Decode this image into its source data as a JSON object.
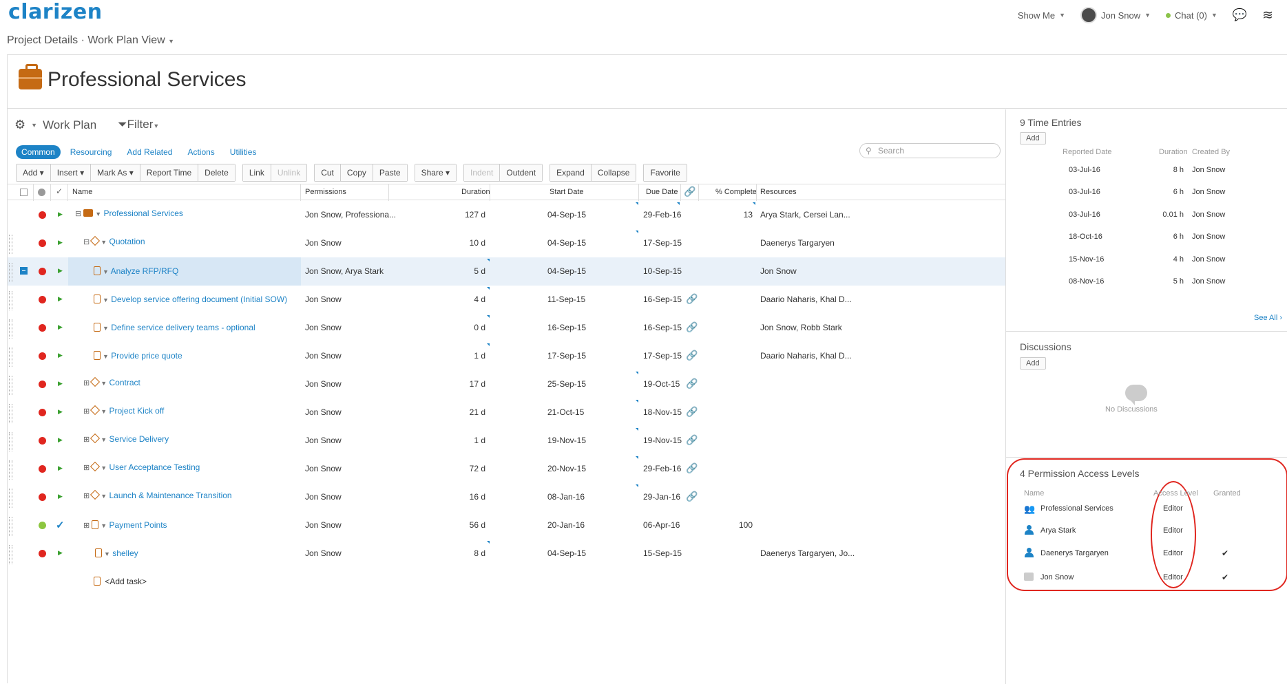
{
  "app": {
    "logo": "clarizen"
  },
  "topnav": {
    "show_me": "Show Me",
    "user": "Jon Snow",
    "chat": "Chat (0)"
  },
  "breadcrumb": "Project Details · Work Plan View",
  "page_title": "Professional Services",
  "workplan": {
    "label": "Work Plan",
    "filter": "Filter"
  },
  "subtabs": [
    "Common",
    "Resourcing",
    "Add Related",
    "Actions",
    "Utilities"
  ],
  "search_placeholder": "Search",
  "toolbar": {
    "g1": [
      "Add ▾",
      "Insert ▾",
      "Mark As ▾",
      "Report Time",
      "Delete"
    ],
    "g2": [
      "Link",
      "Unlink"
    ],
    "g3": [
      "Cut",
      "Copy",
      "Paste"
    ],
    "g4": [
      "Share ▾"
    ],
    "g5": [
      "Indent",
      "Outdent"
    ],
    "g6": [
      "Expand",
      "Collapse"
    ],
    "g7": [
      "Favorite"
    ]
  },
  "columns": {
    "name": "Name",
    "permissions": "Permissions",
    "duration": "Duration",
    "start": "Start Date",
    "due": "Due Date",
    "complete": "% Complete",
    "resources": "Resources"
  },
  "rows": [
    {
      "name": "Professional Services",
      "perm": "Jon Snow, Professiona...",
      "dur": "127 d",
      "start": "04-Sep-15",
      "due": "29-Feb-16",
      "pct": "13",
      "res": "Arya  Stark, Cersei  Lan..."
    },
    {
      "name": "Quotation",
      "perm": "Jon Snow",
      "dur": "10 d",
      "start": "04-Sep-15",
      "due": "17-Sep-15",
      "pct": "",
      "res": "Daenerys Targaryen"
    },
    {
      "name": "Analyze RFP/RFQ",
      "perm": "Jon Snow, Arya Stark",
      "dur": "5 d",
      "start": "04-Sep-15",
      "due": "10-Sep-15",
      "pct": "",
      "res": "Jon Snow"
    },
    {
      "name": "Develop service offering document (Initial SOW)",
      "perm": "Jon Snow",
      "dur": "4 d",
      "start": "11-Sep-15",
      "due": "16-Sep-15",
      "pct": "",
      "res": "Daario  Naharis, Khal  D..."
    },
    {
      "name": "Define service delivery teams - optional",
      "perm": "Jon Snow",
      "dur": "0 d",
      "start": "16-Sep-15",
      "due": "16-Sep-15",
      "pct": "",
      "res": "Jon Snow, Robb Stark"
    },
    {
      "name": "Provide price quote",
      "perm": "Jon Snow",
      "dur": "1 d",
      "start": "17-Sep-15",
      "due": "17-Sep-15",
      "pct": "",
      "res": "Daario  Naharis, Khal  D..."
    },
    {
      "name": "Contract",
      "perm": "Jon Snow",
      "dur": "17 d",
      "start": "25-Sep-15",
      "due": "19-Oct-15",
      "pct": "",
      "res": ""
    },
    {
      "name": "Project Kick off",
      "perm": "Jon Snow",
      "dur": "21 d",
      "start": "21-Oct-15",
      "due": "18-Nov-15",
      "pct": "",
      "res": ""
    },
    {
      "name": "Service Delivery",
      "perm": "Jon Snow",
      "dur": "1 d",
      "start": "19-Nov-15",
      "due": "19-Nov-15",
      "pct": "",
      "res": ""
    },
    {
      "name": "User Acceptance Testing",
      "perm": "Jon Snow",
      "dur": "72 d",
      "start": "20-Nov-15",
      "due": "29-Feb-16",
      "pct": "",
      "res": ""
    },
    {
      "name": "Launch & Maintenance Transition",
      "perm": "Jon Snow",
      "dur": "16 d",
      "start": "08-Jan-16",
      "due": "29-Jan-16",
      "pct": "",
      "res": ""
    },
    {
      "name": "Payment Points",
      "perm": "Jon Snow",
      "dur": "56 d",
      "start": "20-Jan-16",
      "due": "06-Apr-16",
      "pct": "100",
      "res": ""
    },
    {
      "name": "shelley",
      "perm": "Jon Snow",
      "dur": "8 d",
      "start": "04-Sep-15",
      "due": "15-Sep-15",
      "pct": "",
      "res": "Daenerys Targaryen, Jo..."
    }
  ],
  "add_task": "<Add task>",
  "time_entries": {
    "title": "9 Time Entries",
    "add": "Add",
    "headers": {
      "date": "Reported Date",
      "duration": "Duration",
      "created_by": "Created By"
    },
    "entries": [
      {
        "date": "03-Jul-16",
        "dur": "8 h",
        "by": "Jon Snow"
      },
      {
        "date": "03-Jul-16",
        "dur": "6 h",
        "by": "Jon Snow"
      },
      {
        "date": "03-Jul-16",
        "dur": "0.01 h",
        "by": "Jon Snow"
      },
      {
        "date": "18-Oct-16",
        "dur": "6 h",
        "by": "Jon Snow"
      },
      {
        "date": "15-Nov-16",
        "dur": "4 h",
        "by": "Jon Snow"
      },
      {
        "date": "08-Nov-16",
        "dur": "5 h",
        "by": "Jon Snow"
      }
    ],
    "see_all": "See All ›"
  },
  "discussions": {
    "title": "Discussions",
    "add": "Add",
    "empty": "No Discussions"
  },
  "permissions": {
    "title": "4 Permission Access Levels",
    "headers": {
      "name": "Name",
      "level": "Access Level",
      "granted": "Granted"
    },
    "entries": [
      {
        "name": "Professional Services",
        "level": "Editor",
        "granted": ""
      },
      {
        "name": "Arya  Stark",
        "level": "Editor",
        "granted": ""
      },
      {
        "name": "Daenerys Targaryen",
        "level": "Editor",
        "granted": "✔"
      },
      {
        "name": "Jon Snow",
        "level": "Editor",
        "granted": "✔"
      }
    ]
  },
  "colors": {
    "accent": "#1d83c6",
    "status_red": "#e0261f",
    "status_green": "#8cc63f",
    "highlight": "#e0261f"
  }
}
